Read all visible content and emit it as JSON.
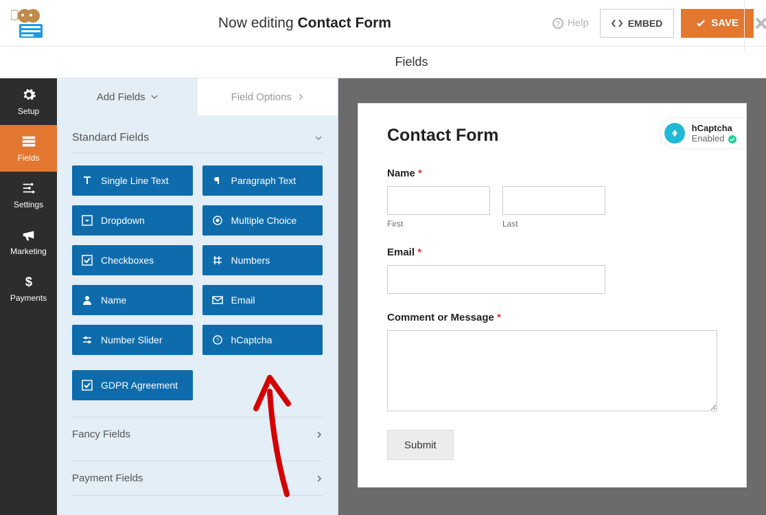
{
  "toolbar": {
    "editing_prefix": "Now editing ",
    "form_name": "Contact Form",
    "help": "Help",
    "embed": "EMBED",
    "save": "SAVE"
  },
  "section_title": "Fields",
  "sidenav": {
    "setup": "Setup",
    "fields": "Fields",
    "settings": "Settings",
    "marketing": "Marketing",
    "payments": "Payments"
  },
  "panel": {
    "tab_add": "Add Fields",
    "tab_opts": "Field Options",
    "group_standard": "Standard Fields",
    "fields": {
      "slt": "Single Line Text",
      "pt": "Paragraph Text",
      "dd": "Dropdown",
      "mc": "Multiple Choice",
      "cb": "Checkboxes",
      "num": "Numbers",
      "name": "Name",
      "email": "Email",
      "ns": "Number Slider",
      "hcap": "hCaptcha",
      "gdpr": "GDPR Agreement"
    },
    "group_fancy": "Fancy Fields",
    "group_pay": "Payment Fields"
  },
  "preview": {
    "title": "Contact Form",
    "badge_name": "hCaptcha",
    "badge_sub": "Enabled",
    "name_label": "Name",
    "first": "First",
    "last": "Last",
    "email_label": "Email",
    "msg_label": "Comment or Message",
    "submit": "Submit"
  }
}
